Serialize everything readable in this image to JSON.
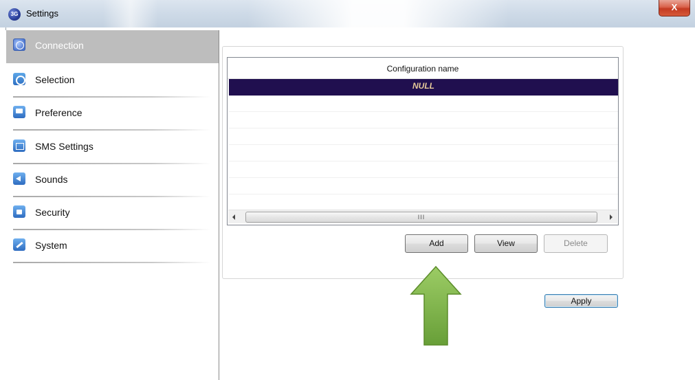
{
  "window": {
    "title": "Settings",
    "app_icon_text": "3G",
    "close_glyph": "X"
  },
  "sidebar": {
    "items": [
      {
        "label": "Connection",
        "icon": "globe-icon",
        "active": true
      },
      {
        "label": "Selection",
        "icon": "selection-icon",
        "active": false
      },
      {
        "label": "Preference",
        "icon": "monitor-icon",
        "active": false
      },
      {
        "label": "SMS Settings",
        "icon": "envelope-icon",
        "active": false
      },
      {
        "label": "Sounds",
        "icon": "speaker-icon",
        "active": false
      },
      {
        "label": "Security",
        "icon": "lock-icon",
        "active": false
      },
      {
        "label": "System",
        "icon": "wrench-icon",
        "active": false
      }
    ]
  },
  "config_list": {
    "column_header": "Configuration name",
    "rows": [
      "NULL"
    ],
    "selected_row_color": "#200f4f",
    "selected_text_color": "#e6c99a",
    "scrollbar_grip": "III"
  },
  "buttons": {
    "add": "Add",
    "view": "View",
    "delete": "Delete",
    "apply": "Apply"
  },
  "annotation": {
    "arrow_color": "#7cb342",
    "arrow_target": "add-button"
  }
}
